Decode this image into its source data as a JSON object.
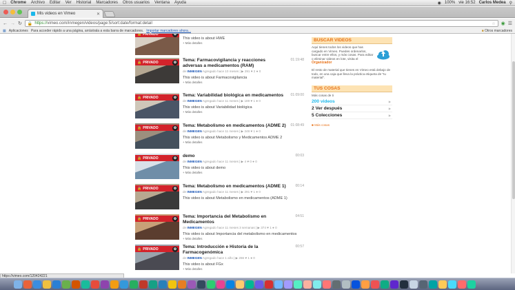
{
  "menubar": {
    "app": "Chrome",
    "items": [
      "Archivo",
      "Editar",
      "Ver",
      "Historial",
      "Marcadores",
      "Otros usuarios",
      "Ventana",
      "Ayuda"
    ],
    "clock": "vie 16:52",
    "user": "Carlos Medea",
    "battery": "100%"
  },
  "tab": {
    "title": "Mis videos en Vimeo"
  },
  "toolbar": {
    "scheme": "https://",
    "url": "vimeo.com/inmegen/videos/page:5/sort:date/format:detail"
  },
  "bookmarks": {
    "apps": "Aplicaciones",
    "hint": "Para acceder rápido a una página, arrástrala a esta barra de marcadores.",
    "import_link": "Importar marcadores ahora...",
    "other": "Otros marcadores"
  },
  "videos": [
    {
      "title": "",
      "duration": "",
      "user": "INMEGEN",
      "age": "Agregado hace 10 meses",
      "plays": "385",
      "likes": "2",
      "comments": "0",
      "desc": "This video is about HWE",
      "more": "+ Más detalles",
      "badge": "PRIVADO",
      "scene": "a"
    },
    {
      "title": "Tema: Farmacovigilancia y reacciones adversas a medicamentos (RAM)",
      "duration": "01:19:48",
      "user": "INMEGEN",
      "age": "Agregado hace 10 meses",
      "plays": "291",
      "likes": "2",
      "comments": "0",
      "desc": "This video is about Farmacovigilancia",
      "more": "+ Más detalles",
      "badge": "PRIVADO",
      "scene": "b"
    },
    {
      "title": "Tema: Variabilidad biológica en medicamentos",
      "duration": "01:09:00",
      "user": "INMEGEN",
      "age": "Agregado hace 11 meses",
      "plays": "189",
      "likes": "1",
      "comments": "0",
      "desc": "This video is about Variabilidad biológica",
      "more": "+ Más detalles",
      "badge": "PRIVADO",
      "scene": "c"
    },
    {
      "title": "Tema: Metabolismo en medicamentos (ADME 2)",
      "duration": "01:08:49",
      "user": "INMEGEN",
      "age": "Agregado hace 11 meses",
      "plays": "248",
      "likes": "1",
      "comments": "0",
      "desc": "This video is about Metabolismo y Medicamentos ADME 2",
      "more": "+ Más detalles",
      "badge": "PRIVADO",
      "scene": "d"
    },
    {
      "title": "demo",
      "duration": "00:03",
      "user": "INMEGEN",
      "age": "Agregado hace 11 meses",
      "plays": "4",
      "likes": "0",
      "comments": "0",
      "desc": "This video is about demo",
      "more": "+ Más detalles",
      "badge": "PRIVADO",
      "scene": "e"
    },
    {
      "title": "Tema: Metabolismo en medicamentos (ADME 1)",
      "duration": "00:14",
      "user": "INMEGEN",
      "age": "Agregado hace 11 meses",
      "plays": "291",
      "likes": "1",
      "comments": "0",
      "desc": "This video is about Metabolismo en medicamentos (ADME 1)",
      "more": "",
      "badge": "PRIVADO",
      "scene": "f"
    },
    {
      "title": "Tema: Importancia del Metabolismo en Medicamentos",
      "duration": "04:51",
      "user": "INMEGEN",
      "age": "Agregado hace 11 meses 3 semanas",
      "plays": "374",
      "likes": "1",
      "comments": "0",
      "desc": "This video is about Importancia del metabolismo en medicamentos",
      "more": "+ Más detalles",
      "badge": "PRIVADO",
      "scene": "g"
    },
    {
      "title": "Tema: Introducción e Historia de la Farmacogenómica",
      "duration": "00:57",
      "user": "INMEGEN",
      "age": "Agregado hace 1 año",
      "plays": "266",
      "likes": "1",
      "comments": "0",
      "desc": "This video is about FGx",
      "more": "+ Más detalles",
      "badge": "PRIVADO",
      "scene": "h"
    }
  ],
  "sidebar": {
    "buscar": {
      "title": "BUSCAR VIDEOS",
      "text1": "Aquí tienes todos los videos que has cargado en Vimeo. Puedes ordenarlos, buscar entre ellos, y más cosas. Para editar o eliminar videos en lote, visita el",
      "link": "Organizador",
      "text2": "El resto de material que tienes en Vimeo está debajo de todo, en una caja que lleva la práctica etiqueta de \"tu material\"."
    },
    "tus": {
      "title": "TUS COSAS",
      "caption": "Más cosas de ti",
      "rows": [
        {
          "label": "200 videos",
          "accent": true
        },
        {
          "label": "2 Ver después",
          "accent": false
        },
        {
          "label": "5 Colecciones",
          "accent": false
        }
      ],
      "footer": "Más cosas"
    }
  },
  "statusbar": "https://vimeo.com/120424221",
  "colors": {
    "accent": "#1ab7ea",
    "privado": "#d3232b",
    "orange": "#e8731a"
  }
}
